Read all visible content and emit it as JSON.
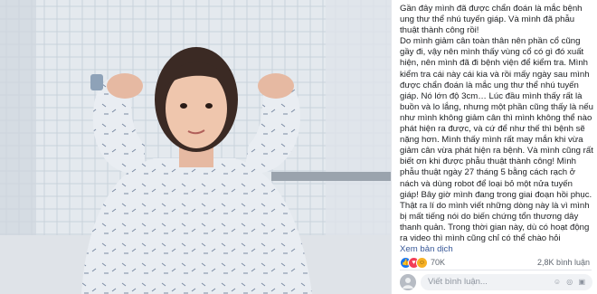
{
  "post": {
    "paragraphs": [
      "Gần đây mình đã được chẩn đoán là mắc bệnh ung thư thể nhú tuyến giáp. Và mình đã phẫu thuật thành công rồi!",
      "Do mình giảm cân toàn thân nên phần cổ cũng gầy đi, vậy nên mình thấy vùng cổ có gì đó xuất hiện, nên mình đã đi bệnh viện để kiểm tra. Mình kiểm tra cái này cái kia và rồi mấy ngày sau mình được chẩn đoán là mắc ung thư thể nhú tuyến giáp. Nó lớn độ 3cm… Lúc đầu mình thấy rất là buồn và lo lắng, nhưng một phần cũng thấy là nếu như mình không giảm cân thì mình không thể nào phát hiện ra được, và cứ để như thế thì bệnh sẽ nặng hơn. Mình thấy mình rất may mắn khi vừa giảm cân vừa phát hiện ra bệnh. Và mình cũng rất biết ơn khi được phẫu thuật thành công! Mình phẫu thuật ngày 27 tháng 5 bằng cách rạch ở nách và dùng robot để loại bỏ một nửa tuyến giáp! Bây giờ mình đang trong giai đoạn hồi phục. Thật ra lí do mình viết những dòng này là vì mình bị mất tiếng nói do biến chứng tổn thương dây thanh quản. Trong thời gian này, dù có hoạt động ra video thì mình cũng chỉ có thể chào hỏi"
    ],
    "see_translation": "Xem bản dịch"
  },
  "reactions": {
    "count": "70K",
    "comments": "2,8K bình luận",
    "icons": [
      "like-icon",
      "love-icon",
      "haha-icon"
    ]
  },
  "comment_input": {
    "placeholder": "Viết bình luận..."
  },
  "colors": {
    "link": "#385898",
    "text": "#1c1e21",
    "meta": "#606770",
    "like": "#1877f2",
    "love": "#f33e58",
    "haha": "#f7b125"
  }
}
